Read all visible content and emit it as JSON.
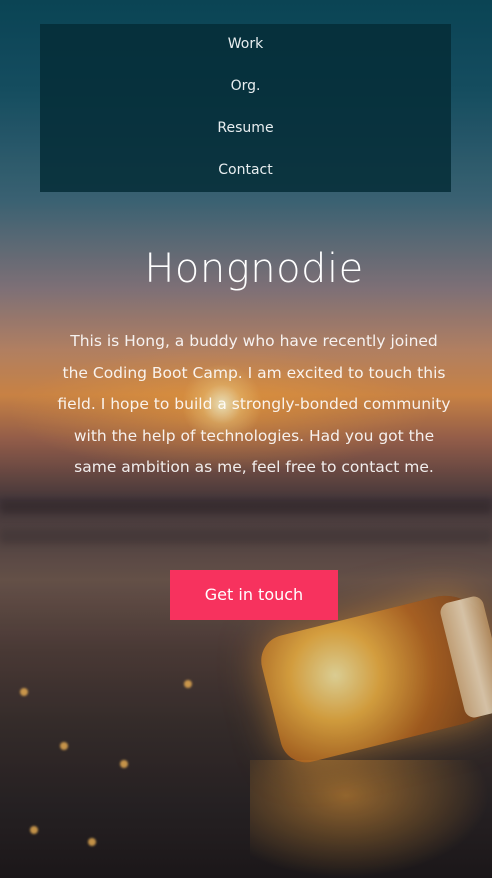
{
  "nav": {
    "items": [
      {
        "label": "Work"
      },
      {
        "label": "Org."
      },
      {
        "label": "Resume"
      },
      {
        "label": "Contact"
      }
    ]
  },
  "hero": {
    "title": "Hongnodie",
    "bio": "This is Hong, a buddy who have recently joined the Coding Boot Camp. I am excited to touch this field. I hope to build a strongly-bonded community with the help of technologies. Had you got the same ambition as me, feel free to contact me.",
    "cta_label": "Get in touch"
  },
  "colors": {
    "menu_background": "#052d37",
    "cta_background": "#f7325e",
    "text": "#ffffff"
  }
}
